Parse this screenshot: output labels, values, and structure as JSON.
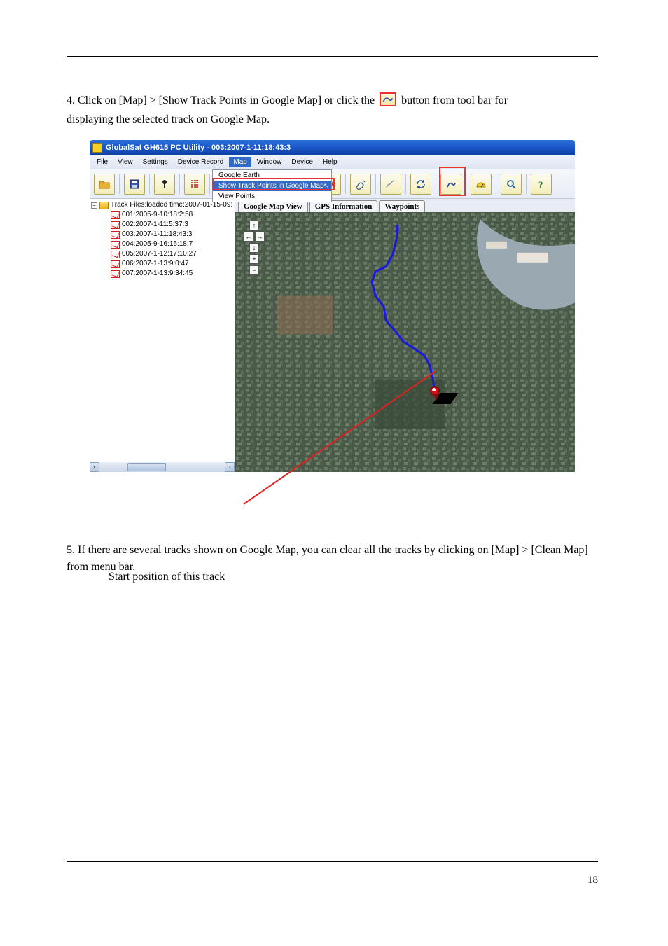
{
  "page": {
    "number": "18",
    "instruction_1_prefix": "4. Click on [Map] > [Show Track Points in Google Map] or click the",
    "instruction_1_suffix": "button from tool bar for",
    "instruction_1_line2": "displaying the selected track on Google Map.",
    "callout_below": "Start position of this track",
    "instruction_2": "5. If there are several tracks shown on Google Map, you can clear all the tracks by clicking on [Map] > [Clean Map] from menu bar."
  },
  "app": {
    "title": "GlobalSat GH615 PC Utility - 003:2007-1-11:18:43:3",
    "menus": [
      "File",
      "View",
      "Settings",
      "Device Record",
      "Map",
      "Window",
      "Device",
      "Help"
    ],
    "active_menu_index": 4,
    "map_menu_items": [
      "Google Earth",
      "Show Track Points in Google Map",
      "View Points"
    ],
    "highlighted_menu_index": 1
  },
  "tree": {
    "root": "Track Files:loaded time:2007-01-15-09:",
    "items": [
      "001:2005-9-10:18:2:58",
      "002:2007-1-11:5:37:3",
      "003:2007-1-11:18:43:3",
      "004:2005-9-16:16:18:7",
      "005:2007-1-12:17:10:27",
      "006:2007-1-13:9:0:47",
      "007:2007-1-13:9:34:45"
    ]
  },
  "tabs": [
    "Google Map View",
    "GPS Information",
    "Waypoints"
  ],
  "nav_symbols": {
    "up": "↑",
    "down": "↓",
    "left": "←",
    "right": "→",
    "plus": "+",
    "minus": "−"
  }
}
